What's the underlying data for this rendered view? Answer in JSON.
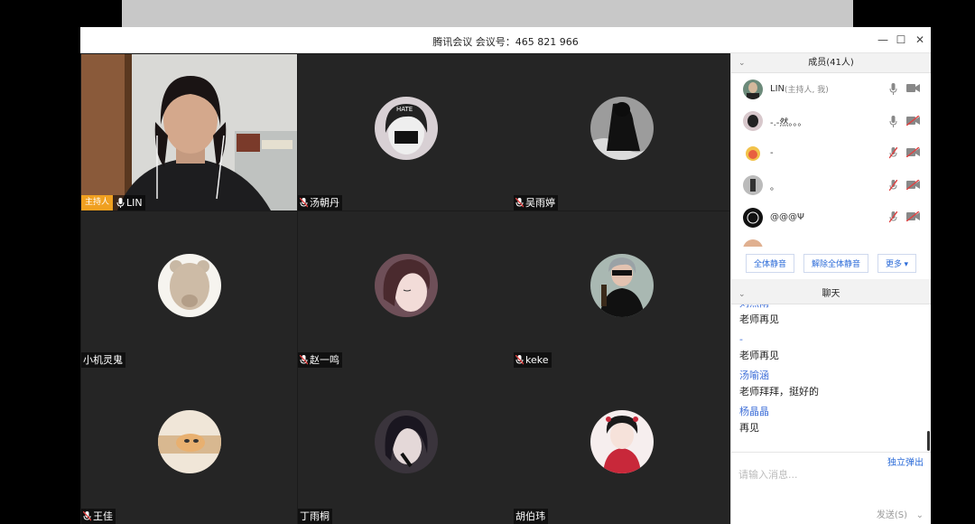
{
  "window": {
    "title": "腾讯会议 会议号：465 821 966",
    "minimize": "—",
    "maximize": "☐",
    "close": "✕"
  },
  "tiles": [
    {
      "name": "LIN",
      "host_badge": "主持人",
      "type": "video"
    },
    {
      "name": "汤朝丹",
      "type": "avatar",
      "avatar_color": "#d8d0d4"
    },
    {
      "name": "吴雨婷",
      "type": "avatar",
      "avatar_color": "#3a3a3a"
    },
    {
      "name": "小机灵鬼",
      "type": "avatar",
      "avatar_color": "#f2efe8"
    },
    {
      "name": "赵一鸣",
      "type": "avatar",
      "avatar_color": "#8a6a6a"
    },
    {
      "name": "keke",
      "type": "avatar",
      "avatar_color": "#9aa9a4"
    },
    {
      "name": "王佳",
      "type": "avatar",
      "avatar_color": "#e8c9a0"
    },
    {
      "name": "丁雨桐",
      "type": "avatar",
      "avatar_color": "#3c3640"
    },
    {
      "name": "胡伯玮",
      "type": "avatar",
      "avatar_color": "#f4e8e8"
    }
  ],
  "members_panel": {
    "title": "成员(41人)",
    "items": [
      {
        "name": "LIN",
        "note": "(主持人, 我)",
        "mic": "on",
        "cam": "on",
        "avatar_color": "#6c8a7a"
      },
      {
        "name": "-.-然。。。",
        "note": "",
        "mic": "on",
        "cam": "off",
        "avatar_color": "#d8c8cc"
      },
      {
        "name": "-",
        "note": "",
        "mic": "muted",
        "cam": "off",
        "avatar_color": "#f2c24a"
      },
      {
        "name": "。",
        "note": "",
        "mic": "muted",
        "cam": "off",
        "avatar_color": "#888"
      },
      {
        "name": "@@@Ψ",
        "note": "",
        "mic": "muted",
        "cam": "off",
        "avatar_color": "#111"
      }
    ],
    "buttons": {
      "mute_all": "全体静音",
      "unmute_all": "解除全体静音",
      "more": "更多 ▾"
    }
  },
  "chat_panel": {
    "title": "聊天",
    "partial_sender": "刘燕雨",
    "messages": [
      {
        "sender": "",
        "text": "老师再见"
      },
      {
        "sender": "-",
        "text": "老师再见"
      },
      {
        "sender": "汤喻涵",
        "text": "老师拜拜，挺好的"
      },
      {
        "sender": "杨晶晶",
        "text": "再见"
      }
    ],
    "popout": "独立弹出",
    "input_placeholder": "请输入消息...",
    "send": "发送(S)",
    "send_arrow": "⌄"
  },
  "colors": {
    "accent": "#2b6bd8",
    "host_badge": "#f0a020",
    "muted_red": "#e04040"
  }
}
